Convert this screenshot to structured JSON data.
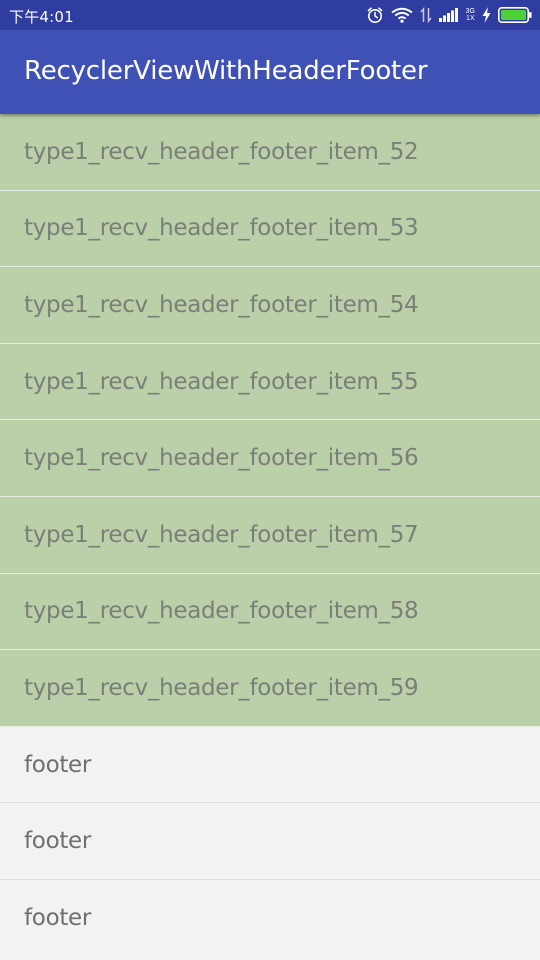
{
  "status_bar": {
    "time": "下午4:01",
    "net_top": "3G",
    "net_bottom": "1X"
  },
  "app_bar": {
    "title": "RecyclerViewWithHeaderFooter"
  },
  "items": [
    "type1_recv_header_footer_item_52",
    "type1_recv_header_footer_item_53",
    "type1_recv_header_footer_item_54",
    "type1_recv_header_footer_item_55",
    "type1_recv_header_footer_item_56",
    "type1_recv_header_footer_item_57",
    "type1_recv_header_footer_item_58",
    "type1_recv_header_footer_item_59"
  ],
  "footers": [
    "footer",
    "footer",
    "footer"
  ],
  "colors": {
    "status_bar": "#2f3da0",
    "app_bar": "#3f51b5",
    "item_bg": "#bbcfa8",
    "footer_bg": "#f2f2f2",
    "battery": "#4cd137"
  }
}
